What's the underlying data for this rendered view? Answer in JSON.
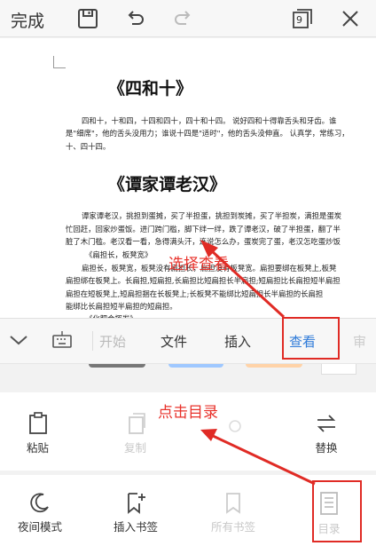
{
  "topbar": {
    "done_label": "完成",
    "page_badge": "9"
  },
  "document": {
    "title1": "《四和十》",
    "para1": [
      "四和十，十和四，十四和四十，四十和十四。 说好四和十得靠舌头和牙齿。谁",
      "是\"细席\"，他的舌头没用力；谁说十四是\"适时\"，他的舌头没伸直。 认真学，常练习，",
      "十、四十四。"
    ],
    "title2": "《谭家谭老汉》",
    "para2": [
      "谭家谭老汉，挑担到蛋摊，买了半担蛋，挑担到炭摊，买了半担炭，满担是蛋炭",
      "忙回赶，回家炒蛋饭。进门跨门槛，脚下绊一绊，跌了谭老汉，破了半担蛋，翻了半",
      "脏了木门槛。老汉看一看，急得满头汗，连说怎么办，蛋炭完了蛋，老汉怎吃蛋炒饭"
    ],
    "para3": [
      "《扁担长，板凳宽》",
      "扁担长，板凳宽，板凳没有扁担长，扁担没有板凳宽。扁担要绑在板凳上,板凳",
      "扁担绑在板凳上。长扁担,短扁担,长扁担比短扁担长半扁担;短扁担比长扁担短半扁担",
      "扁担在短板凳上,短扁担捆在长板凳上;长板凳不能绑比短扁担长半扁担的长扁担",
      "能绑比长扁担短半扁担的短扁担。",
      "《化肥会挥发》"
    ],
    "annotation_select": "选择查看",
    "annotation_click": "点击目录"
  },
  "toolbar": {
    "tabs": [
      "开始",
      "文件",
      "插入",
      "查看",
      "审"
    ]
  },
  "panel1": {
    "items": [
      "粘贴",
      "复制",
      "",
      "替换"
    ]
  },
  "panel2": {
    "items": [
      "夜间模式",
      "插入书签",
      "所有书签",
      "目录"
    ]
  },
  "colors": {
    "accent_blue": "#2f7bd9",
    "annotation_red": "#e02b25"
  }
}
